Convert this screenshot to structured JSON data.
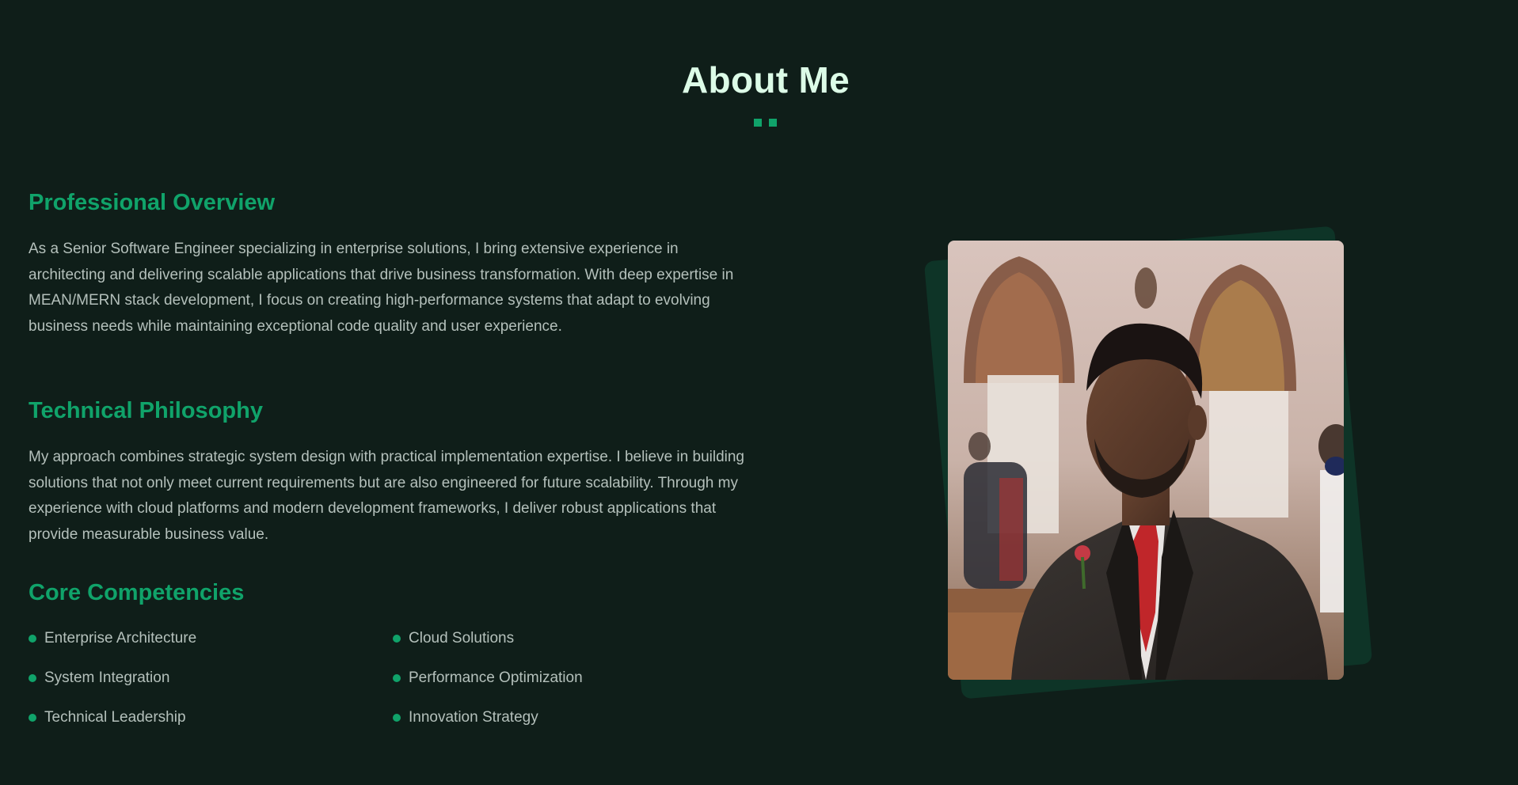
{
  "about": {
    "title": "About Me",
    "sections": {
      "overview": {
        "heading": "Professional Overview",
        "body": "As a Senior Software Engineer specializing in enterprise solutions, I bring extensive experience in architecting and delivering scalable applications that drive business transformation. With deep expertise in MEAN/MERN stack development, I focus on creating high-performance systems that adapt to evolving business needs while maintaining exceptional code quality and user experience."
      },
      "philosophy": {
        "heading": "Technical Philosophy",
        "body": "My approach combines strategic system design with practical implementation expertise. I believe in building solutions that not only meet current requirements but are also engineered for future scalability. Through my experience with cloud platforms and modern development frameworks, I deliver robust applications that provide measurable business value."
      },
      "competencies": {
        "heading": "Core Competencies",
        "items": [
          "Enterprise Architecture",
          "Cloud Solutions",
          "System Integration",
          "Performance Optimization",
          "Technical Leadership",
          "Innovation Strategy"
        ]
      }
    }
  },
  "colors": {
    "background": "#0f1e19",
    "accent": "#10a36a",
    "title": "#dcfce7",
    "body_text": "#b4c0bb",
    "photo_backdrop": "#0e3427"
  },
  "icons": {
    "bullet": "bullet-dot-icon",
    "title_decoration": "title-dots-icon"
  }
}
